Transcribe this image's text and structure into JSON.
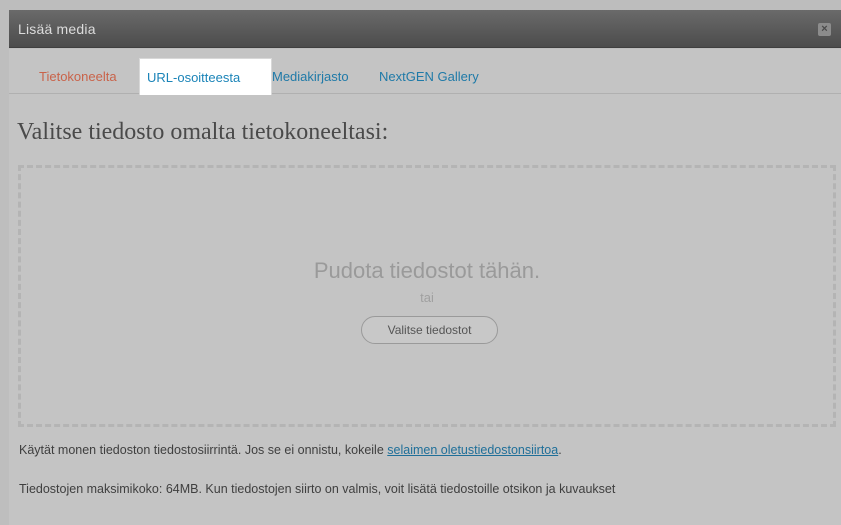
{
  "window": {
    "title": "Lisää media",
    "close_symbol": "×",
    "close_icon": "close-icon"
  },
  "tabs": [
    {
      "label": "Tietokoneelta",
      "state": "inactive",
      "color": "#c9634a"
    },
    {
      "label": "URL-osoitteesta",
      "state": "active",
      "color": "#1b84b8"
    },
    {
      "label": "Mediakirjasto",
      "state": "inactive",
      "color": "#1f7aa8"
    },
    {
      "label": "NextGEN Gallery",
      "state": "inactive",
      "color": "#1f7aa8"
    }
  ],
  "upload": {
    "heading": "Valitse tiedosto omalta tietokoneeltasi:",
    "drop_text": "Pudota tiedostot tähän.",
    "or_text": "tai",
    "select_button": "Valitse tiedostot"
  },
  "info": {
    "line1_prefix": "Käytät monen tiedoston tiedostosiirrintä. Jos se ei onnistu, kokeile ",
    "line1_link": "selaimen oletustiedostonsiirtoa",
    "line1_suffix": ".",
    "line2": "Tiedostojen maksimikoko: 64MB. Kun tiedostojen siirto on valmis, voit lisätä tiedostoille otsikon ja kuvaukset"
  }
}
